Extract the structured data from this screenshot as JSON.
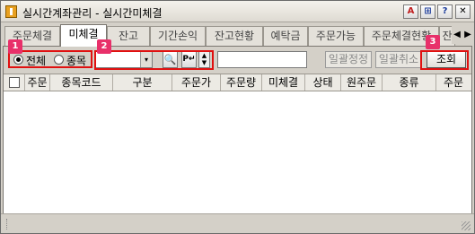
{
  "window": {
    "title": "실시간계좌관리 - 실시간미체결",
    "buttons": [
      "A",
      "⊞",
      "?",
      "✕"
    ]
  },
  "tabs": [
    {
      "label": "주문체결",
      "active": false
    },
    {
      "label": "미체결",
      "active": true
    },
    {
      "label": "잔고",
      "active": false
    },
    {
      "label": "기간손익",
      "active": false
    },
    {
      "label": "잔고현황",
      "active": false
    },
    {
      "label": "예탁금",
      "active": false
    },
    {
      "label": "주문가능",
      "active": false
    },
    {
      "label": "주문체결현황",
      "active": false
    },
    {
      "label": "잔",
      "active": false
    }
  ],
  "tab_scroll": {
    "left": "◀",
    "right": "▶"
  },
  "filter": {
    "radio_all_label": "전체",
    "radio_stock_label": "종목",
    "selected": "전체"
  },
  "combo": {
    "value": "",
    "arrow": "▾"
  },
  "search_icon": "🔍",
  "p_icon": "P↵",
  "spin": {
    "up": "▲",
    "down": "▼"
  },
  "text_input": {
    "value": ""
  },
  "buttons": {
    "bulk_modify": "일괄정정",
    "bulk_cancel": "일괄취소",
    "query": "조회"
  },
  "markers": [
    "1",
    "2",
    "3"
  ],
  "grid": {
    "columns": [
      "주문",
      "종목코드",
      "구분",
      "주문가",
      "주문량",
      "미체결",
      "상태",
      "원주문",
      "종류",
      "주문"
    ]
  },
  "scrollbar": {
    "left": "◀",
    "right": "▶"
  },
  "colors": {
    "marker": "#e8306a",
    "highlight": "#e01010"
  }
}
